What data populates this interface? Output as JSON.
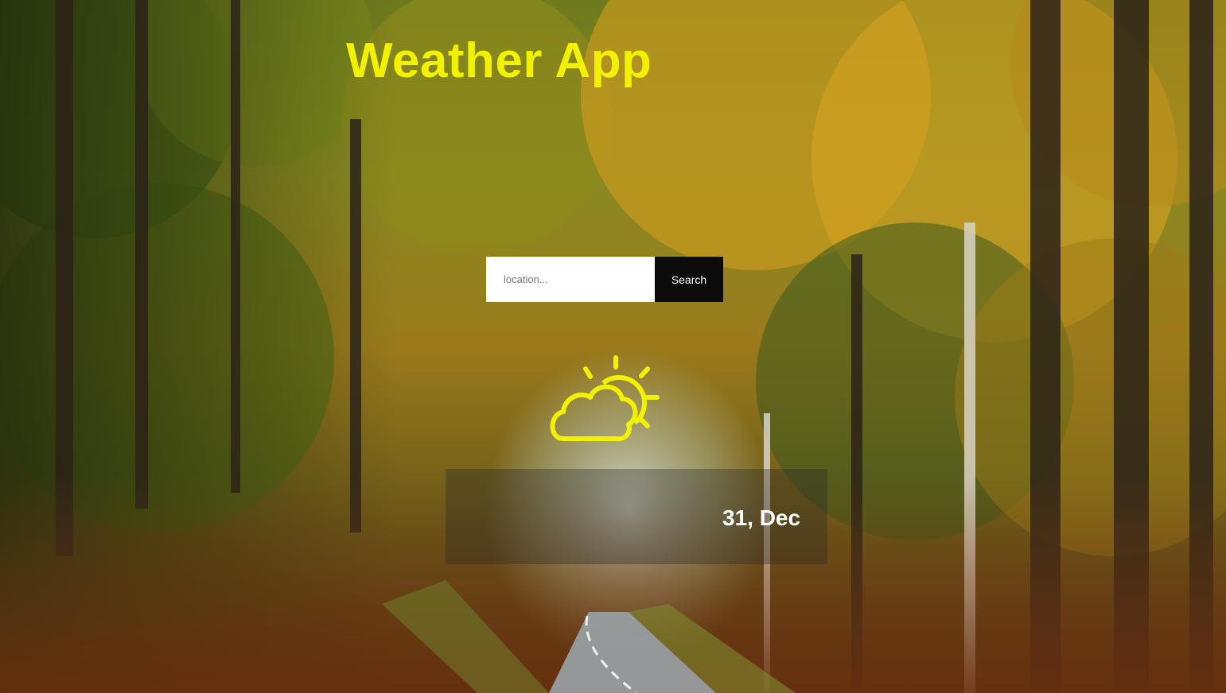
{
  "header": {
    "title": "Weather App",
    "title_color": "#f2f200"
  },
  "search": {
    "placeholder": "location...",
    "value": "",
    "button_label": "Search"
  },
  "weather": {
    "icon": "partly-cloudy-icon",
    "icon_color": "#f2f200",
    "date": "31, Dec"
  },
  "background": {
    "scene": "autumn-forest-road-photo"
  }
}
